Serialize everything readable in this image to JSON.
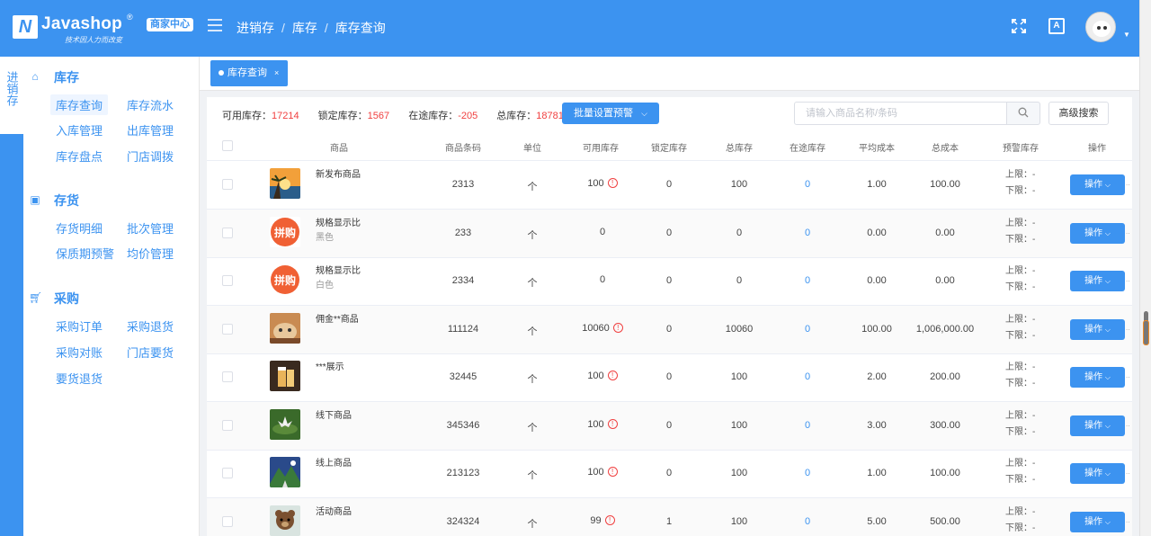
{
  "brand": {
    "logo_mark": "N",
    "name": "Javashop",
    "registered": "®",
    "slogan": "技术因人力而改变",
    "badge": "商家中心"
  },
  "breadcrumb": [
    "进销存",
    "库存",
    "库存查询"
  ],
  "header_icons": {
    "fullscreen": "fullscreen-icon",
    "language": "A"
  },
  "sidebar1": {
    "label": "进销存"
  },
  "sidebar2": {
    "groups": [
      {
        "title": "库存",
        "icon": "home-icon",
        "links": [
          "库存查询",
          "库存流水",
          "入库管理",
          "出库管理",
          "库存盘点",
          "门店调拨"
        ]
      },
      {
        "title": "存货",
        "icon": "box-icon",
        "links": [
          "存货明细",
          "批次管理",
          "保质期预警",
          "均价管理"
        ]
      },
      {
        "title": "采购",
        "icon": "cart-icon",
        "links": [
          "采购订单",
          "采购退货",
          "采购对账",
          "门店要货",
          "要货退货"
        ]
      }
    ]
  },
  "tab": {
    "label": "库存查询",
    "close": "×"
  },
  "summary": {
    "available_label": "可用库存：",
    "available": "17214",
    "locked_label": "锁定库存：",
    "locked": "1567",
    "transit_label": "在途库存：",
    "transit": "-205",
    "total_label": "总库存：",
    "total": "18781"
  },
  "toolbar": {
    "batch_label": "批量设置预警",
    "search_placeholder": "请输入商品名称/条码",
    "advanced_label": "高级搜索"
  },
  "table": {
    "columns": [
      "商品",
      "商品条码",
      "单位",
      "可用库存",
      "锁定库存",
      "总库存",
      "在途库存",
      "平均成本",
      "总成本",
      "预警库存",
      "操作"
    ],
    "upper_label": "上限：",
    "lower_label": "下限：",
    "op_label": "操作",
    "rows": [
      {
        "name": "新发布商品",
        "spec": "",
        "barcode": "2313",
        "unit": "个",
        "available": "100",
        "warn": true,
        "locked": "0",
        "total": "100",
        "transit": "0",
        "avg_cost": "1.00",
        "total_cost": "100.00",
        "upper": "-",
        "lower": "-",
        "thumb": "sunset"
      },
      {
        "name": "规格显示比",
        "spec": "黑色",
        "barcode": "233",
        "unit": "个",
        "available": "0",
        "warn": false,
        "locked": "0",
        "total": "0",
        "transit": "0",
        "avg_cost": "0.00",
        "total_cost": "0.00",
        "upper": "-",
        "lower": "-",
        "thumb": "pingou"
      },
      {
        "name": "规格显示比",
        "spec": "白色",
        "barcode": "2334",
        "unit": "个",
        "available": "0",
        "warn": false,
        "locked": "0",
        "total": "0",
        "transit": "0",
        "avg_cost": "0.00",
        "total_cost": "0.00",
        "upper": "-",
        "lower": "-",
        "thumb": "pingou"
      },
      {
        "name": "佣金**商品",
        "spec": "",
        "barcode": "111124",
        "unit": "个",
        "available": "10060",
        "warn": true,
        "locked": "0",
        "total": "10060",
        "transit": "0",
        "avg_cost": "100.00",
        "total_cost": "1,006,000.00",
        "upper": "-",
        "lower": "-",
        "thumb": "cat"
      },
      {
        "name": "***展示",
        "spec": "",
        "barcode": "32445",
        "unit": "个",
        "available": "100",
        "warn": true,
        "locked": "0",
        "total": "100",
        "transit": "0",
        "avg_cost": "2.00",
        "total_cost": "200.00",
        "upper": "-",
        "lower": "-",
        "thumb": "drink"
      },
      {
        "name": "线下商品",
        "spec": "",
        "barcode": "345346",
        "unit": "个",
        "available": "100",
        "warn": true,
        "locked": "0",
        "total": "100",
        "transit": "0",
        "avg_cost": "3.00",
        "total_cost": "300.00",
        "upper": "-",
        "lower": "-",
        "thumb": "lotus"
      },
      {
        "name": "线上商品",
        "spec": "",
        "barcode": "213123",
        "unit": "个",
        "available": "100",
        "warn": true,
        "locked": "0",
        "total": "100",
        "transit": "0",
        "avg_cost": "1.00",
        "total_cost": "100.00",
        "upper": "-",
        "lower": "-",
        "thumb": "mountain"
      },
      {
        "name": "活动商品",
        "spec": "",
        "barcode": "324324",
        "unit": "个",
        "available": "99",
        "warn": true,
        "locked": "1",
        "total": "100",
        "transit": "0",
        "avg_cost": "5.00",
        "total_cost": "500.00",
        "upper": "-",
        "lower": "-",
        "thumb": "bear"
      }
    ]
  },
  "colors": {
    "primary": "#3c93f0",
    "warn": "#f04040",
    "transit_link": "#3c93f0"
  }
}
